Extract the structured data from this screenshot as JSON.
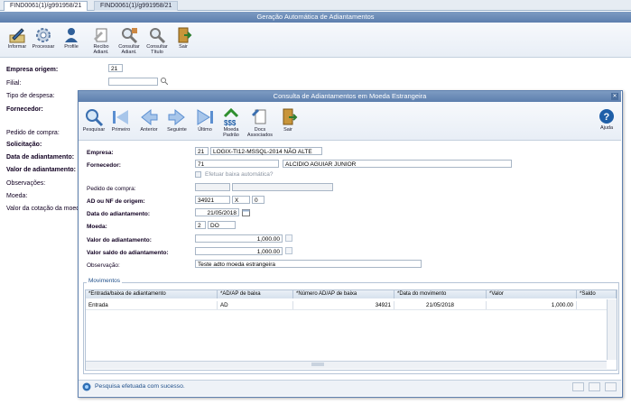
{
  "tabs": [
    {
      "label": "FIND0061(1)/g991958/21"
    },
    {
      "label": "FIND0061(1)/g991958/21"
    }
  ],
  "main_window": {
    "title": "Geração Automática de Adiantamentos",
    "toolbar": [
      {
        "label": "Informar",
        "icon": "pencil-icon"
      },
      {
        "label": "Processar",
        "icon": "gears-icon"
      },
      {
        "label": "Profile",
        "icon": "user-icon"
      },
      {
        "label": "Recibo Adiant.",
        "icon": "receipt-icon"
      },
      {
        "label": "Consultar Adiant.",
        "icon": "search-advance-icon"
      },
      {
        "label": "Consultar Título",
        "icon": "search-title-icon"
      },
      {
        "label": "Sair",
        "icon": "exit-door-icon"
      }
    ],
    "form": {
      "empresa_origem_label": "Empresa origem:",
      "empresa_origem_value": "21",
      "filial_label": "Filial:",
      "tipo_despesa_label": "Tipo de despesa:",
      "fornecedor_label": "Fornecedor:",
      "pedido_label": "Pedido de compra:",
      "solicitacao_label": "Solicitação:",
      "data_adiantamento_label": "Data de adiantamento:",
      "valor_adiantamento_label": "Valor de adiantamento:",
      "observacoes_label": "Observações:",
      "moeda_label": "Moeda:",
      "valor_cotacao_label": "Valor da cotação da moeda"
    }
  },
  "modal": {
    "title": "Consulta de Adiantamentos em Moeda Estrangeira",
    "close_glyph": "✕",
    "toolbar": [
      {
        "label": "Pesquisar",
        "icon": "magnifier-icon"
      },
      {
        "label": "Primeiro",
        "icon": "first-arrow-icon"
      },
      {
        "label": "Anterior",
        "icon": "previous-arrow-icon"
      },
      {
        "label": "Seguinte",
        "icon": "next-arrow-icon"
      },
      {
        "label": "Último",
        "icon": "last-arrow-icon"
      },
      {
        "label": "Moeda Padrão",
        "icon": "coins-icon"
      },
      {
        "label": "Docs Associados",
        "icon": "documents-icon"
      },
      {
        "label": "Sair",
        "icon": "exit-door-icon"
      }
    ],
    "help_label": "Ajuda",
    "fields": {
      "empresa_label": "Empresa:",
      "empresa_code": "21",
      "empresa_name": "LOGIX-TI12-MSSQL-2014 NÃO ALTE",
      "fornecedor_label": "Fornecedor:",
      "fornecedor_code": "71",
      "fornecedor_name": "ALCIDIO AGUIAR JUNIOR",
      "efetuar_baixa_label": "Efetuar baixa automática?",
      "pedido_label": "Pedido de compra:",
      "ad_nf_label": "AD ou NF de origem:",
      "ad_nf_number": "34921",
      "ad_nf_type": "X",
      "ad_nf_seq": "0",
      "data_label": "Data do adiantamento:",
      "data_value": "21/05/2018",
      "moeda_label": "Moeda:",
      "moeda_code": "2",
      "moeda_name": "DO",
      "valor_label": "Valor do adiantamento:",
      "valor_value": "1,000.00",
      "saldo_label": "Valor saldo do adiantamento:",
      "saldo_value": "1,000.00",
      "observacao_label": "Observação:",
      "observacao_value": "Teste adto moeda estrangeira"
    },
    "movimentos": {
      "legend": "Movimentos",
      "columns": [
        "*Entrada/baixa de adiantamento",
        "*AD/AP de baixa",
        "*Número AD/AP de baixa",
        "*Data do movimento",
        "*Valor",
        "*Saldo"
      ],
      "rows": [
        [
          "Entrada",
          "AD",
          "34921",
          "21/05/2018",
          "1,000.00",
          ""
        ]
      ]
    },
    "status": {
      "message": "Pesquisa efetuada com sucesso."
    }
  }
}
